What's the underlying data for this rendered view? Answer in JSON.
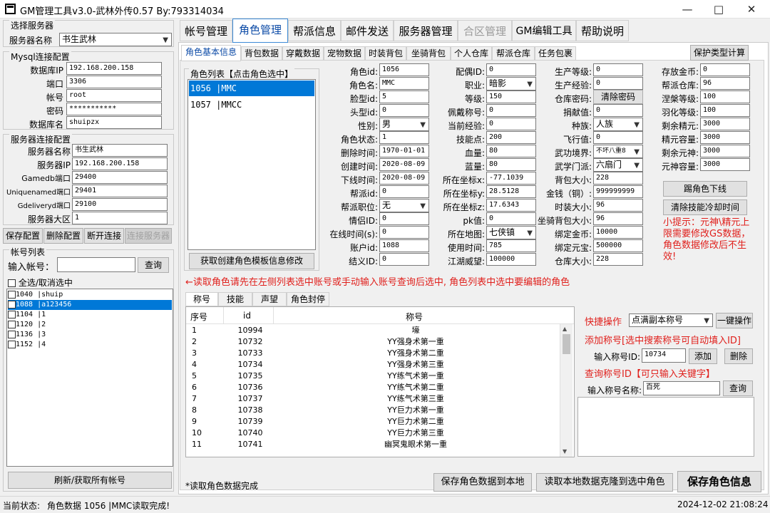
{
  "window": {
    "title": "GM管理工具v3.0-武林外传0.57 By:793314034",
    "min": "—",
    "max": "□",
    "close": "✕"
  },
  "left": {
    "select_server": {
      "title": "选择服务器",
      "name_label": "服务器名称",
      "name_value": "书生武林"
    },
    "mysql": {
      "title": "Mysql连接配置",
      "fields": [
        {
          "label": "数据库IP",
          "value": "192.168.200.158"
        },
        {
          "label": "端口",
          "value": "3306"
        },
        {
          "label": "帐号",
          "value": "root"
        },
        {
          "label": "密码",
          "value": "***********"
        },
        {
          "label": "数据库名",
          "value": "shuipzx"
        }
      ]
    },
    "server_conn": {
      "title": "服务器连接配置",
      "fields": [
        {
          "label": "服务器名称",
          "value": "书生武林"
        },
        {
          "label": "服务器IP",
          "value": "192.168.200.158"
        },
        {
          "label": "Gamedb端口",
          "value": "29400"
        },
        {
          "label": "Uniquenamed端口",
          "value": "29401"
        },
        {
          "label": "Gdeliveryd端口",
          "value": "29100"
        },
        {
          "label": "服务器大区",
          "value": "1"
        }
      ]
    },
    "buttons": {
      "save": "保存配置",
      "delete": "删除配置",
      "disconnect": "断开连接",
      "connect": "连接服务器"
    },
    "accounts": {
      "title": "帐号列表",
      "input_label": "输入帐号：",
      "query": "查询",
      "select_all": "全选/取消选中",
      "items": [
        {
          "text": "1040 |shuip"
        },
        {
          "text": "1088 |a123456"
        },
        {
          "text": "1104 |1"
        },
        {
          "text": "1120 |2"
        },
        {
          "text": "1136 |3"
        },
        {
          "text": "1152 |4"
        }
      ],
      "refresh": "刷新/获取所有帐号"
    }
  },
  "tabs": [
    "帐号管理",
    "角色管理",
    "帮派信息",
    "邮件发送",
    "服务器管理",
    "合区管理",
    "GM编辑工具",
    "帮助说明"
  ],
  "subtabs": [
    "角色基本信息",
    "背包数据",
    "穿戴数据",
    "宠物数据",
    "时装背包",
    "坐骑背包",
    "个人仓库",
    "帮派仓库",
    "任务包裹"
  ],
  "protect_btn": "保护类型计算",
  "role_list": {
    "title": "角色列表【点击角色选中】",
    "items": [
      {
        "text": "1056 |MMC"
      },
      {
        "text": "1057 |MMCC"
      }
    ],
    "template_btn": "获取创建角色模板信息修改"
  },
  "col1": [
    {
      "label": "角色id:",
      "value": "1056"
    },
    {
      "label": "角色名:",
      "value": "MMC"
    },
    {
      "label": "脸型id:",
      "value": "5"
    },
    {
      "label": "头型id:",
      "value": "0"
    },
    {
      "label": "性别:",
      "value": "男"
    },
    {
      "label": "角色状态:",
      "value": "1"
    },
    {
      "label": "删除时间:",
      "value": "1970-01-01 0"
    },
    {
      "label": "创建时间:",
      "value": "2020-08-09 2"
    },
    {
      "label": "下线时间:",
      "value": "2020-08-09 2"
    },
    {
      "label": "帮派id:",
      "value": "0"
    },
    {
      "label": "帮派职位:",
      "value": "无"
    },
    {
      "label": "情侣ID:",
      "value": "0"
    },
    {
      "label": "在线时间(s):",
      "value": "0"
    },
    {
      "label": "账户id:",
      "value": "1088"
    },
    {
      "label": "结义ID:",
      "value": "0"
    }
  ],
  "col2": [
    {
      "label": "配偶ID:",
      "value": "0"
    },
    {
      "label": "职业:",
      "value": "暗影"
    },
    {
      "label": "等级:",
      "value": "150"
    },
    {
      "label": "佩戴称号:",
      "value": "0"
    },
    {
      "label": "当前经验:",
      "value": "0"
    },
    {
      "label": "技能点:",
      "value": "200"
    },
    {
      "label": "血量:",
      "value": "80"
    },
    {
      "label": "蓝量:",
      "value": "80"
    },
    {
      "label": "所在坐标x:",
      "value": "-77.1039"
    },
    {
      "label": "所在坐标y:",
      "value": "28.5128"
    },
    {
      "label": "所在坐标z:",
      "value": "17.6343"
    },
    {
      "label": "pk值:",
      "value": "0"
    },
    {
      "label": "所在地图:",
      "value": "七侠镇"
    },
    {
      "label": "使用时间:",
      "value": "785"
    },
    {
      "label": "江湖威望:",
      "value": "100000"
    }
  ],
  "col3": [
    {
      "label": "生产等级:",
      "value": "0"
    },
    {
      "label": "生产经验:",
      "value": "0"
    },
    {
      "label": "仓库密码:",
      "value": "清除密码"
    },
    {
      "label": "捐献值:",
      "value": "0"
    },
    {
      "label": "种族:",
      "value": "人族"
    },
    {
      "label": "飞行值:",
      "value": "0"
    },
    {
      "label": "武功境界:",
      "value": "不坏八重8"
    },
    {
      "label": "武学门派:",
      "value": "六扇门"
    },
    {
      "label": "背包大小:",
      "value": "228"
    },
    {
      "label": "金钱（铜）:",
      "value": "999999999"
    },
    {
      "label": "时装大小:",
      "value": "96"
    },
    {
      "label": "坐骑背包大小:",
      "value": "96"
    },
    {
      "label": "绑定金币:",
      "value": "10000"
    },
    {
      "label": "绑定元宝:",
      "value": "500000"
    },
    {
      "label": "仓库大小:",
      "value": "228"
    }
  ],
  "col4": [
    {
      "label": "存放金币:",
      "value": "0"
    },
    {
      "label": "帮派仓库:",
      "value": "96"
    },
    {
      "label": "涅槃等级:",
      "value": "100"
    },
    {
      "label": "羽化等级:",
      "value": "100"
    },
    {
      "label": "剩余精元:",
      "value": "3000"
    },
    {
      "label": "精元容量:",
      "value": "3000"
    },
    {
      "label": "剩余元神:",
      "value": "3000"
    },
    {
      "label": "元神容量:",
      "value": "3000"
    }
  ],
  "kick_btn": "踢角色下线",
  "clear_cd_btn": "清除技能冷却时间",
  "tip": "小提示：元神\\精元上限需要修改GS数据，角色数据修改后不生效!",
  "notice": "←读取角色请先在左侧列表选中账号或手动输入账号查询后选中, 角色列表中选中要编辑的角色",
  "bottom_tabs": [
    "称号",
    "技能",
    "声望",
    "角色封停"
  ],
  "table": {
    "headers": [
      "序号",
      "id",
      "称号"
    ],
    "rows": [
      [
        "1",
        "10994",
        "壕"
      ],
      [
        "2",
        "10732",
        "YY强身术第一重"
      ],
      [
        "3",
        "10733",
        "YY强身术第二重"
      ],
      [
        "4",
        "10734",
        "YY强身术第三重"
      ],
      [
        "5",
        "10735",
        "YY练气术第一重"
      ],
      [
        "6",
        "10736",
        "YY练气术第二重"
      ],
      [
        "7",
        "10737",
        "YY练气术第三重"
      ],
      [
        "8",
        "10738",
        "YY巨力术第一重"
      ],
      [
        "9",
        "10739",
        "YY巨力术第二重"
      ],
      [
        "10",
        "10740",
        "YY巨力术第三重"
      ],
      [
        "11",
        "10741",
        "幽冥鬼眼术第一重"
      ]
    ]
  },
  "quick": {
    "label": "快捷操作",
    "select": "点满副本称号",
    "button": "一键操作"
  },
  "add_title": {
    "header": "添加称号[选中搜索称号可自动填入ID]",
    "id_label": "输入称号ID:",
    "id_value": "10734",
    "add": "添加",
    "del": "删除"
  },
  "search_title": {
    "header": "查询称号ID【可只输入关键字】",
    "name_label": "输入称号名称:",
    "name_value": "百死",
    "query": "查询"
  },
  "read_status": "*读取角色数据完成",
  "btn_save_local": "保存角色数据到本地",
  "btn_clone": "读取本地数据克隆到选中角色",
  "btn_save": "保存角色信息",
  "status_bar": {
    "label": "当前状态:",
    "text": "角色数据 1056 |MMC读取完成!",
    "time": "2024-12-02 21:08:24"
  },
  "colors": {
    "accent": "#0078d7",
    "red": "#e0201c",
    "select_bg": "#0078d7"
  }
}
